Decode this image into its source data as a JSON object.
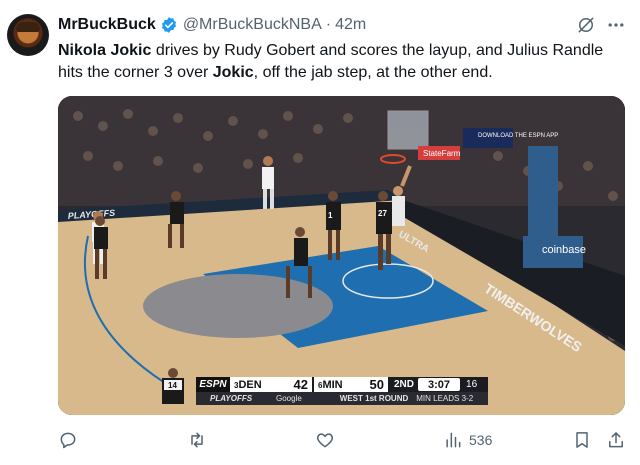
{
  "tweet": {
    "display_name": "MrBuckBuck",
    "handle": "@MrBuckBuckNBA",
    "separator": "·",
    "time": "42m",
    "text": {
      "p1_bold": "Nikola Jokic",
      "p2": " drives by Rudy Gobert and scores the layup, and Julius Randle hits the corner 3 over ",
      "p3_bold": "Jokic",
      "p4": ", off the jab step, at the other end."
    }
  },
  "media": {
    "scorebug": {
      "network": "ESPN",
      "away_team": "DEN",
      "away_score": "42",
      "home_team": "MIN",
      "home_seed": "6",
      "away_seed": "3",
      "home_score": "50",
      "period": "2ND",
      "clock": "3:07",
      "shot_clock": "16",
      "playoffs_label": "PLAYOFFS",
      "sponsor": "Google",
      "round_label": "WEST 1st ROUND",
      "series_label": "MIN LEADS 3-2"
    },
    "court_text": {
      "baseline_brand": "TIMBERWOLVES",
      "lane_brand": "ULTRA",
      "sponsor_1": "coinbase",
      "sponsor_2": "StateFarm",
      "sideline": "PLAYOFFS",
      "rail": "DOWNLOAD THE ESPN APP"
    },
    "jerseys": [
      "14",
      "27",
      "1"
    ]
  },
  "actions": {
    "views": "536"
  },
  "icons": {
    "verified": "verified-badge-icon",
    "grok": "grok-icon",
    "more": "more-icon",
    "reply": "reply-icon",
    "retweet": "retweet-icon",
    "like": "like-icon",
    "views": "views-icon",
    "bookmark": "bookmark-icon",
    "share": "share-icon"
  },
  "colors": {
    "accent": "#1d9bf0",
    "muted": "#536471",
    "court_blue": "#1f6fb0"
  }
}
